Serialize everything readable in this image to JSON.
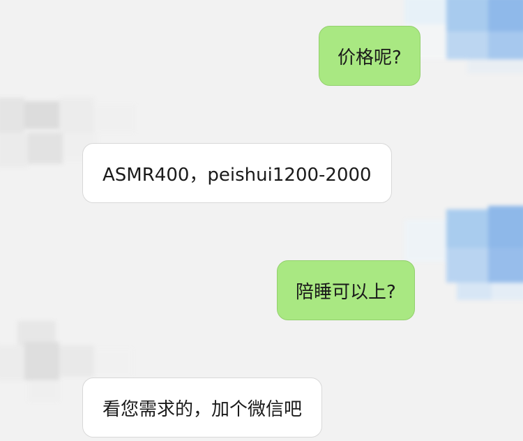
{
  "messages": [
    {
      "side": "me",
      "text": "价格呢?"
    },
    {
      "side": "them",
      "text": "ASMR400，peishui1200-2000"
    },
    {
      "side": "me",
      "text": "陪睡可以上?"
    },
    {
      "side": "them",
      "text": "看您需求的，加个微信吧"
    }
  ],
  "colors": {
    "background": "#f2f2f2",
    "me_bubble": "#a9e882",
    "them_bubble": "#ffffff",
    "avatar_blue": "#9cc3ee",
    "avatar_gray": "#e0e0e0"
  }
}
